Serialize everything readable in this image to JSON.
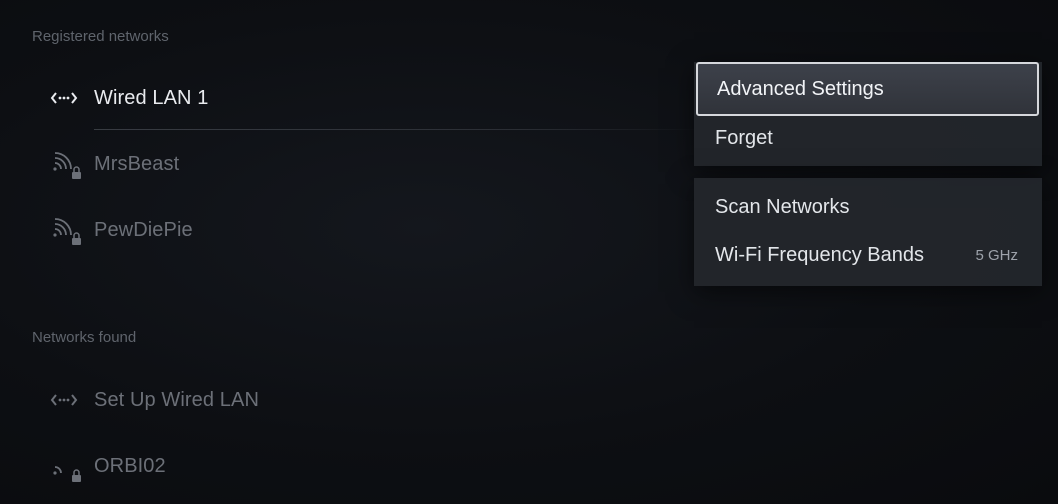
{
  "registered": {
    "label": "Registered networks",
    "networks": [
      {
        "name": "Wired LAN 1",
        "icon": "wired-lan-icon"
      },
      {
        "name": "MrsBeast",
        "icon": "wifi-locked-icon"
      },
      {
        "name": "PewDiePie",
        "icon": "wifi-locked-icon"
      }
    ]
  },
  "found": {
    "label": "Networks found",
    "networks": [
      {
        "name": "Set Up Wired LAN",
        "icon": "wired-lan-icon"
      },
      {
        "name": "ORBI02",
        "icon": "wifi-locked-weak-icon"
      }
    ]
  },
  "menu": {
    "group1": [
      {
        "label": "Advanced Settings"
      },
      {
        "label": "Forget"
      }
    ],
    "group2": [
      {
        "label": "Scan Networks"
      },
      {
        "label": "Wi-Fi Frequency Bands",
        "value": "5 GHz"
      }
    ]
  },
  "colors": {
    "background": "#0d0f13",
    "menu_panel": "#24272d",
    "focus_border": "#d6d8dc",
    "text_primary": "#e9ebef",
    "text_dim": "#6c7078",
    "section_label": "#5f646c"
  }
}
